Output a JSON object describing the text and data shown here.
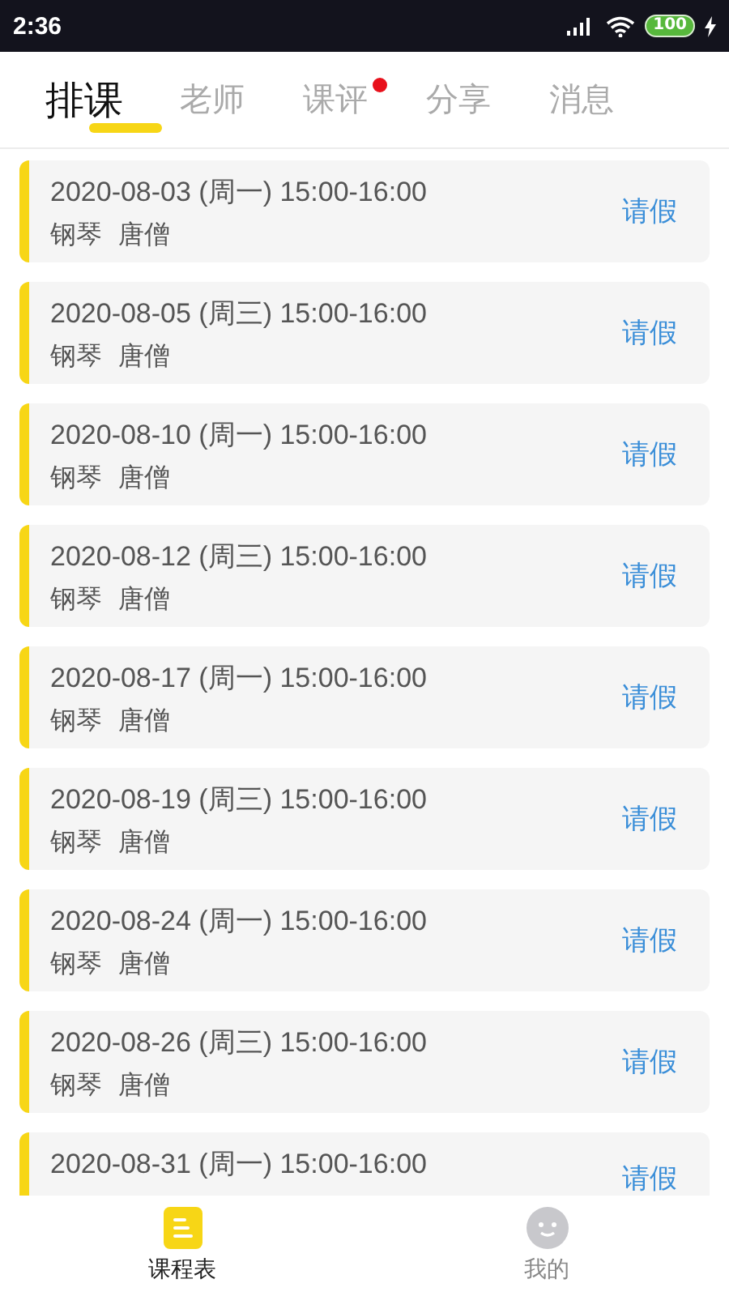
{
  "status_bar": {
    "time": "2:36",
    "battery": "100"
  },
  "tabs": [
    {
      "label": "排课",
      "selected": true,
      "dot": false
    },
    {
      "label": "老师",
      "selected": false,
      "dot": false
    },
    {
      "label": "课评",
      "selected": false,
      "dot": true
    },
    {
      "label": "分享",
      "selected": false,
      "dot": false
    },
    {
      "label": "消息",
      "selected": false,
      "dot": false
    }
  ],
  "lessons": [
    {
      "datetime": "2020-08-03 (周一) 15:00-16:00",
      "course": "钢琴",
      "teacher": "唐僧",
      "action": "请假"
    },
    {
      "datetime": "2020-08-05 (周三) 15:00-16:00",
      "course": "钢琴",
      "teacher": "唐僧",
      "action": "请假"
    },
    {
      "datetime": "2020-08-10 (周一) 15:00-16:00",
      "course": "钢琴",
      "teacher": "唐僧",
      "action": "请假"
    },
    {
      "datetime": "2020-08-12 (周三) 15:00-16:00",
      "course": "钢琴",
      "teacher": "唐僧",
      "action": "请假"
    },
    {
      "datetime": "2020-08-17 (周一) 15:00-16:00",
      "course": "钢琴",
      "teacher": "唐僧",
      "action": "请假"
    },
    {
      "datetime": "2020-08-19 (周三) 15:00-16:00",
      "course": "钢琴",
      "teacher": "唐僧",
      "action": "请假"
    },
    {
      "datetime": "2020-08-24 (周一) 15:00-16:00",
      "course": "钢琴",
      "teacher": "唐僧",
      "action": "请假"
    },
    {
      "datetime": "2020-08-26 (周三) 15:00-16:00",
      "course": "钢琴",
      "teacher": "唐僧",
      "action": "请假"
    },
    {
      "datetime": "2020-08-31 (周一) 15:00-16:00",
      "action": "请假"
    }
  ],
  "bottom_nav": [
    {
      "label": "课程表",
      "kind": "schedule",
      "selected": true
    },
    {
      "label": "我的",
      "kind": "profile",
      "selected": false
    }
  ]
}
